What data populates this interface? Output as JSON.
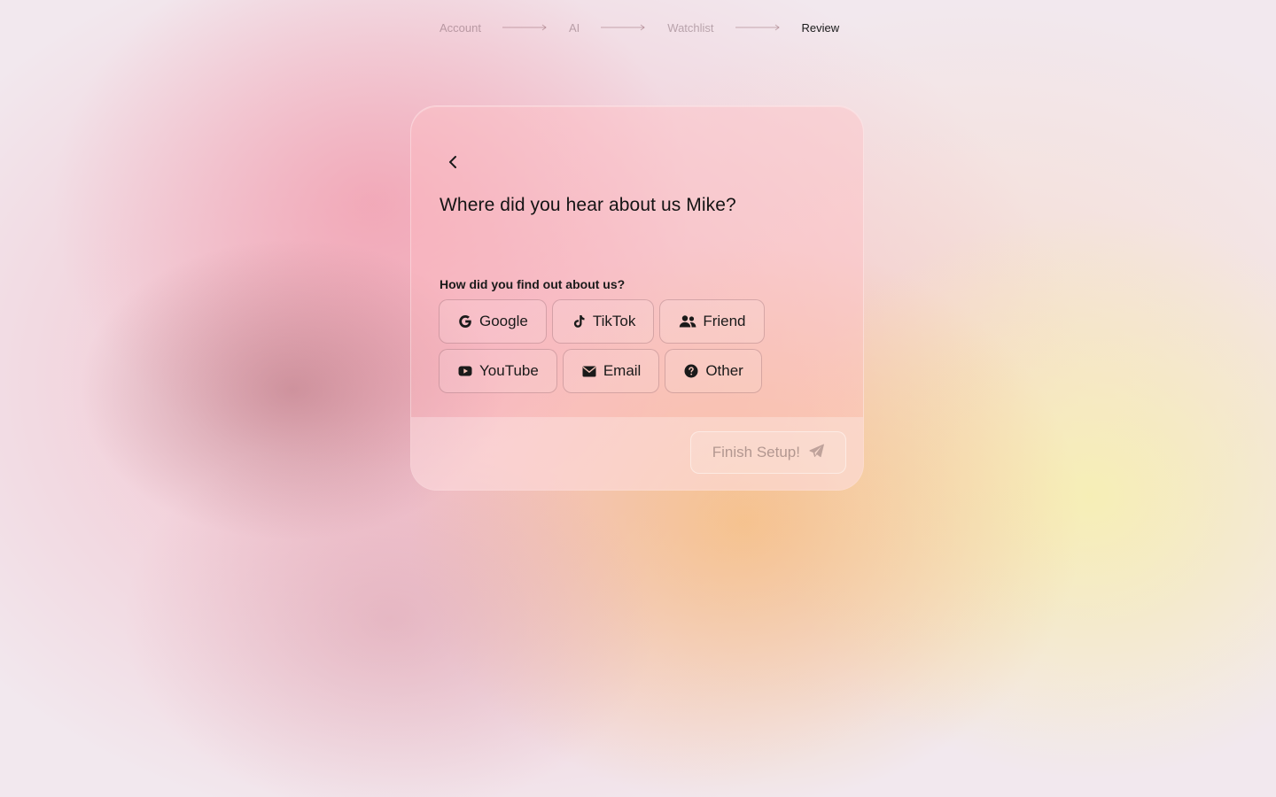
{
  "stepper": {
    "steps": [
      {
        "label": "Account",
        "active": false
      },
      {
        "label": "AI",
        "active": false
      },
      {
        "label": "Watchlist",
        "active": false
      },
      {
        "label": "Review",
        "active": true
      }
    ]
  },
  "card": {
    "back_icon": "chevron-left-icon",
    "title": "Where did you hear about us Mike?",
    "question": "How did you find out about us?",
    "options": [
      {
        "label": "Google",
        "icon": "google-icon"
      },
      {
        "label": "TikTok",
        "icon": "tiktok-icon"
      },
      {
        "label": "Friend",
        "icon": "users-icon"
      },
      {
        "label": "YouTube",
        "icon": "youtube-icon"
      },
      {
        "label": "Email",
        "icon": "envelope-icon"
      },
      {
        "label": "Other",
        "icon": "question-circle-icon"
      }
    ],
    "finish_label": "Finish Setup!",
    "finish_icon": "paper-plane-icon"
  },
  "colors": {
    "text_primary": "#1a1a1a",
    "text_muted": "#b3959c",
    "option_border": "#c4a0a6"
  }
}
